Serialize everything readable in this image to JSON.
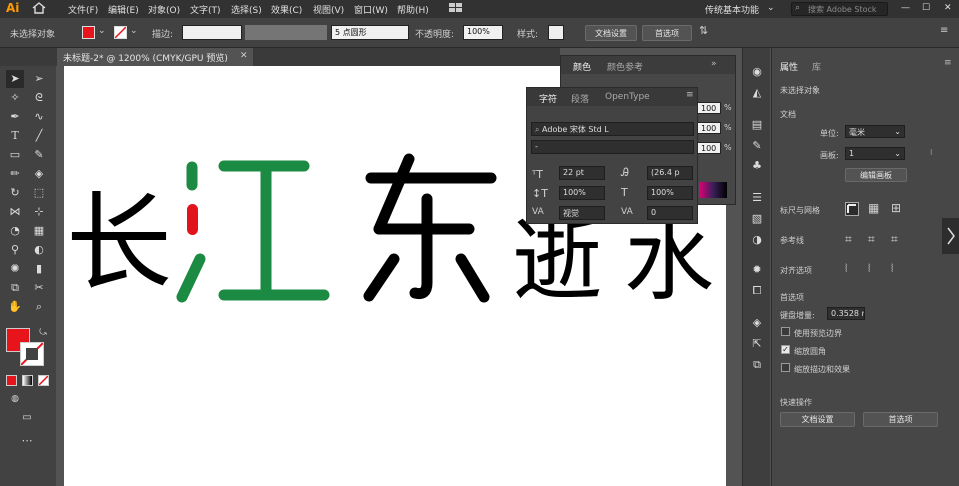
{
  "app": {
    "logo": "Ai"
  },
  "menu": [
    "文件(F)",
    "编辑(E)",
    "对象(O)",
    "文字(T)",
    "选择(S)",
    "效果(C)",
    "视图(V)",
    "窗口(W)",
    "帮助(H)"
  ],
  "workspace": {
    "label": "传统基本功能",
    "search_placeholder": "搜索 Adobe Stock"
  },
  "control_bar": {
    "selection_status": "未选择对象",
    "stroke_label": "描边:",
    "brush_value": "5 点圆形",
    "opacity_label": "不透明度:",
    "opacity_value": "100%",
    "style_label": "样式:",
    "doc_setup_button": "文档设置",
    "prefs_button": "首选项",
    "fill_color": "#e8141c"
  },
  "document_tab": {
    "title": "未标题-2* @ 1200% (CMYK/GPU 预览)"
  },
  "artwork": {
    "chars": [
      "长",
      "江",
      "东",
      "逝",
      "水"
    ],
    "colors": {
      "green": "#1b8a42",
      "red": "#e2141b",
      "black": "#000000"
    }
  },
  "color_panel": {
    "tab_color": "颜色",
    "tab_guide": "颜色参考",
    "values": [
      "100",
      "100",
      "100",
      "100"
    ],
    "unit": "%"
  },
  "char_panel": {
    "tab_char": "字符",
    "tab_para": "段落",
    "tab_opentype": "OpenType",
    "font": "Adobe 宋体 Std L",
    "style": "-",
    "size": "22 pt",
    "leading": "(26.4 p",
    "vscale": "100%",
    "hscale": "100%",
    "kerning": "视觉",
    "tracking": "0"
  },
  "properties": {
    "tab_props": "属性",
    "tab_lib": "库",
    "no_selection": "未选择对象",
    "doc_section": "文档",
    "unit_label": "单位:",
    "unit_value": "毫米",
    "artboard_label": "画板:",
    "artboard_value": "1",
    "edit_artboard": "编辑画板",
    "rulers_label": "标尺与网格",
    "guides_label": "参考线",
    "align_label": "对齐选项",
    "prefs_section": "首选项",
    "keyboard_inc_label": "键盘增量:",
    "keyboard_inc_value": "0.3528 m",
    "preview_bounds": "使用预览边界",
    "scale_corners": "缩放圆角",
    "scale_strokes": "缩放描边和效果",
    "quick_actions": "快速操作",
    "doc_setup": "文档设置",
    "prefs": "首选项",
    "scale_corners_checked": true
  }
}
